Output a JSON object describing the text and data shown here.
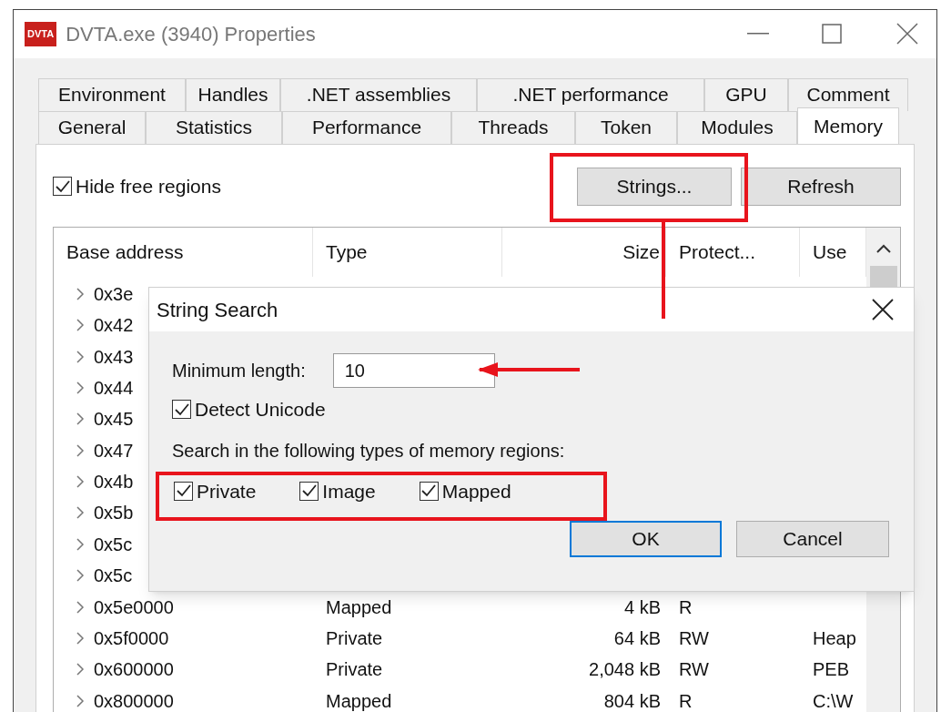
{
  "window": {
    "title": "DVTA.exe (3940) Properties",
    "logo": "DVTA"
  },
  "tabs_back": [
    {
      "label": "Environment",
      "selected": false
    },
    {
      "label": "Handles",
      "selected": false
    },
    {
      "label": ".NET assemblies",
      "selected": false
    },
    {
      "label": ".NET performance",
      "selected": false
    },
    {
      "label": "GPU",
      "selected": false
    },
    {
      "label": "Comment",
      "selected": false
    }
  ],
  "tabs_front": [
    {
      "label": "General",
      "selected": false
    },
    {
      "label": "Statistics",
      "selected": false
    },
    {
      "label": "Performance",
      "selected": false
    },
    {
      "label": "Threads",
      "selected": false
    },
    {
      "label": "Token",
      "selected": false
    },
    {
      "label": "Modules",
      "selected": false
    },
    {
      "label": "Memory",
      "selected": true
    }
  ],
  "hide_free": {
    "label": "Hide free regions",
    "checked": true
  },
  "buttons": [
    {
      "label": "Strings..."
    },
    {
      "label": "Refresh"
    }
  ],
  "table": {
    "columns": [
      "Base address",
      "Type",
      "Size",
      "Protect...",
      "Use"
    ],
    "rows": [
      {
        "cells": [
          "0x3e"
        ]
      },
      {
        "cells": [
          "0x42"
        ]
      },
      {
        "cells": [
          "0x43"
        ]
      },
      {
        "cells": [
          "0x44"
        ]
      },
      {
        "cells": [
          "0x45"
        ]
      },
      {
        "cells": [
          "0x47"
        ]
      },
      {
        "cells": [
          "0x4b"
        ]
      },
      {
        "cells": [
          "0x5b"
        ]
      },
      {
        "cells": [
          "0x5c"
        ]
      },
      {
        "cells": [
          "0x5c"
        ]
      },
      {
        "cells": [
          "0x5e0000",
          "Mapped",
          "4 kB",
          "R",
          ""
        ]
      },
      {
        "cells": [
          "0x5f0000",
          "Private",
          "64 kB",
          "RW",
          "Heap"
        ]
      },
      {
        "cells": [
          "0x600000",
          "Private",
          "2,048 kB",
          "RW",
          "PEB"
        ]
      },
      {
        "cells": [
          "0x800000",
          "Mapped",
          "804 kB",
          "R",
          "C:\\W"
        ]
      }
    ]
  },
  "dialog": {
    "title": "String Search",
    "min_label": "Minimum length:",
    "min_value": "10",
    "unicode": {
      "label": "Detect Unicode",
      "checked": true
    },
    "regions_label": "Search in the following types of memory regions:",
    "regions": [
      {
        "label": "Private",
        "checked": true
      },
      {
        "label": "Image",
        "checked": true
      },
      {
        "label": "Mapped",
        "checked": true
      }
    ],
    "ok": "OK",
    "cancel": "Cancel"
  }
}
